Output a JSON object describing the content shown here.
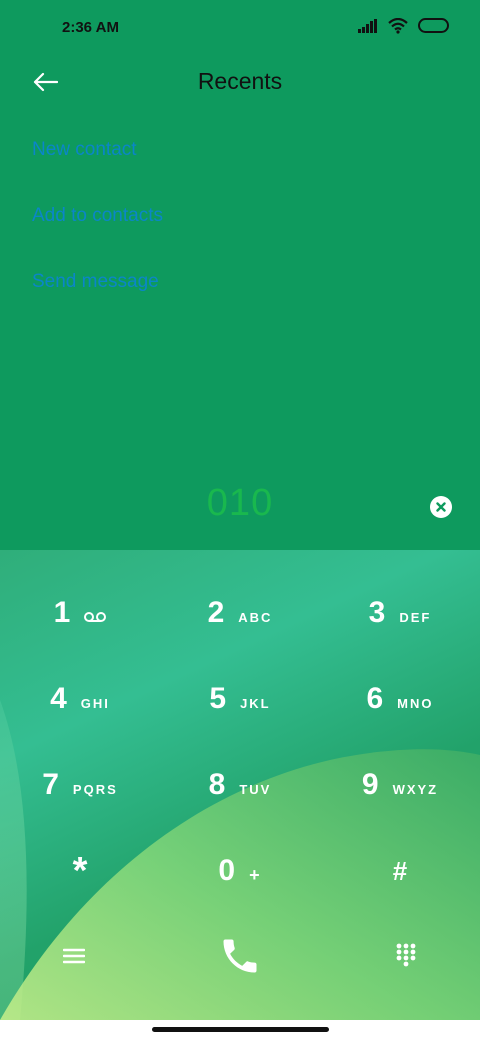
{
  "status_bar": {
    "time": "2:36 AM"
  },
  "header": {
    "title": "Recents"
  },
  "actions": [
    {
      "label": "New contact"
    },
    {
      "label": "Add to contacts"
    },
    {
      "label": "Send message"
    }
  ],
  "dialer": {
    "number": "010"
  },
  "keypad": [
    {
      "digit": "1",
      "letters": ""
    },
    {
      "digit": "2",
      "letters": "ABC"
    },
    {
      "digit": "3",
      "letters": "DEF"
    },
    {
      "digit": "4",
      "letters": "GHI"
    },
    {
      "digit": "5",
      "letters": "JKL"
    },
    {
      "digit": "6",
      "letters": "MNO"
    },
    {
      "digit": "7",
      "letters": "PQRS"
    },
    {
      "digit": "8",
      "letters": "TUV"
    },
    {
      "digit": "9",
      "letters": "WXYZ"
    },
    {
      "digit": "*",
      "letters": ""
    },
    {
      "digit": "0",
      "letters": "+"
    },
    {
      "digit": "#",
      "letters": ""
    }
  ],
  "icons": {
    "back": "back-arrow-icon",
    "clear": "clear-icon",
    "voicemail": "voicemail-icon",
    "menu": "menu-icon",
    "call": "phone-icon",
    "dialpad": "dialpad-icon"
  },
  "colors": {
    "background": "#0e9a5e",
    "link": "#0b86c9",
    "number": "#19b84e"
  }
}
